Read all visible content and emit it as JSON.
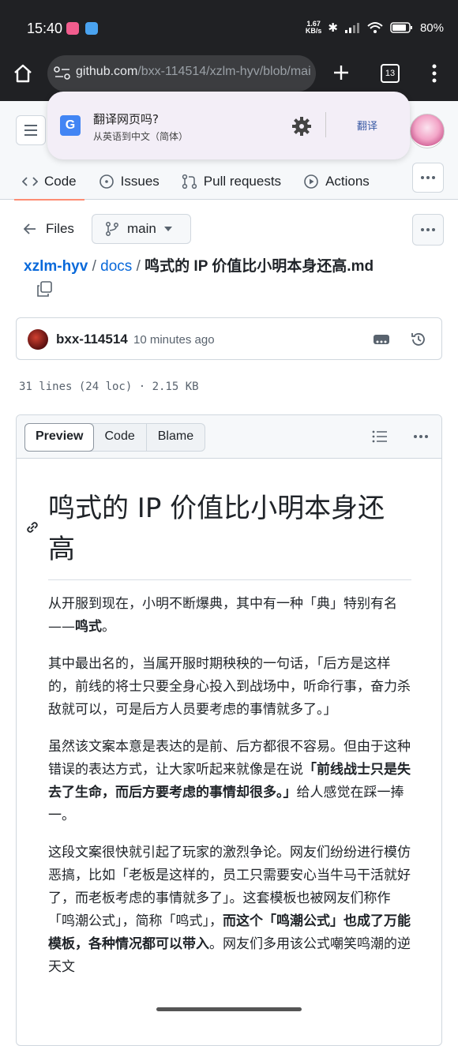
{
  "status_bar": {
    "time": "15:40",
    "net_speed_top": "1.67",
    "net_speed_unit": "KB/s",
    "battery": "80%"
  },
  "browser": {
    "url_host": "github.com",
    "url_path": "/bxx-114514/xzlm-hyv/blob/mai",
    "tab_count": "13"
  },
  "translate_popup": {
    "title": "翻译网页吗?",
    "subtitle": "从英语到中文（简体）",
    "action": "翻译"
  },
  "repo_tabs": [
    {
      "label": "Code"
    },
    {
      "label": "Issues"
    },
    {
      "label": "Pull requests"
    },
    {
      "label": "Actions"
    }
  ],
  "file_nav": {
    "files_label": "Files",
    "branch": "main"
  },
  "breadcrumb": {
    "repo": "xzlm-hyv",
    "sep1": "/",
    "folder": "docs",
    "sep2": "/",
    "file": "鸣式的 IP 价值比小明本身还高.md"
  },
  "commit": {
    "author": "bxx-114514",
    "time": "10 minutes ago"
  },
  "file_info": {
    "lines": "31 lines (24 loc) · 2.15 KB"
  },
  "view_tabs": {
    "preview": "Preview",
    "code": "Code",
    "blame": "Blame"
  },
  "markdown": {
    "heading": "鸣式的 IP 价值比小明本身还高",
    "p1a": "从开服到现在，小明不断爆典，其中有一种「典」特别有名——",
    "p1b": "鸣式",
    "p1c": "。",
    "p2": "其中最出名的，当属开服时期秧秧的一句话，「后方是这样的，前线的将士只要全身心投入到战场中，听命行事，奋力杀敌就可以，可是后方人员要考虑的事情就多了。」",
    "p3a": "虽然该文案本意是表达的是前、后方都很不容易。但由于这种错误的表达方式，让大家听起来就像是在说",
    "p3b": "「前线战士只是失去了生命，而后方要考虑的事情却很多。」",
    "p3c": "给人感觉在踩一捧一。",
    "p4a": "这段文案很快就引起了玩家的激烈争论。网友们纷纷进行模仿恶搞，比如「老板是这样的，员工只需要安心当牛马干活就好了，而老板考虑的事情就多了」。这套模板也被网友们称作「鸣潮公式」，简称「鸣式」，",
    "p4b": "而这个「鸣潮公式」也成了万能模板，各种情况都可以带入",
    "p4c": "。网友们多用该公式嘲笑鸣潮的逆天文"
  }
}
